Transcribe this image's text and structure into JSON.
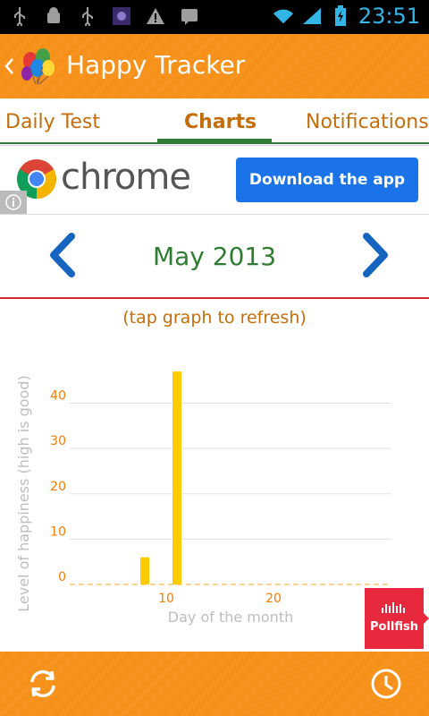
{
  "statusbar": {
    "time": "23:51"
  },
  "app": {
    "title": "Happy Tracker"
  },
  "tabs": [
    {
      "label": "Daily Test"
    },
    {
      "label": "Charts"
    },
    {
      "label": "Notifications"
    }
  ],
  "ad": {
    "brand": "chrome",
    "button_label": "Download the app"
  },
  "month": {
    "label": "May 2013"
  },
  "hint": "(tap graph to refresh)",
  "chart_data": {
    "type": "bar",
    "xlabel": "Day of the month",
    "ylabel": "Level of happiness (high is good)",
    "xlim": [
      1,
      31
    ],
    "ylim": [
      0,
      48
    ],
    "xticks": [
      10,
      20
    ],
    "yticks": [
      0,
      10,
      20,
      30,
      40
    ],
    "grid": true,
    "series": [
      {
        "color": "#ffcc00",
        "points": [
          {
            "x": 8,
            "y": 6
          },
          {
            "x": 11,
            "y": 47
          }
        ]
      }
    ]
  },
  "pollfish": {
    "label": "Pollfish"
  },
  "colors": {
    "accent": "#f7931e",
    "green": "#2e7d32",
    "orange_text": "#c46e0b",
    "bar": "#ffcc00"
  }
}
